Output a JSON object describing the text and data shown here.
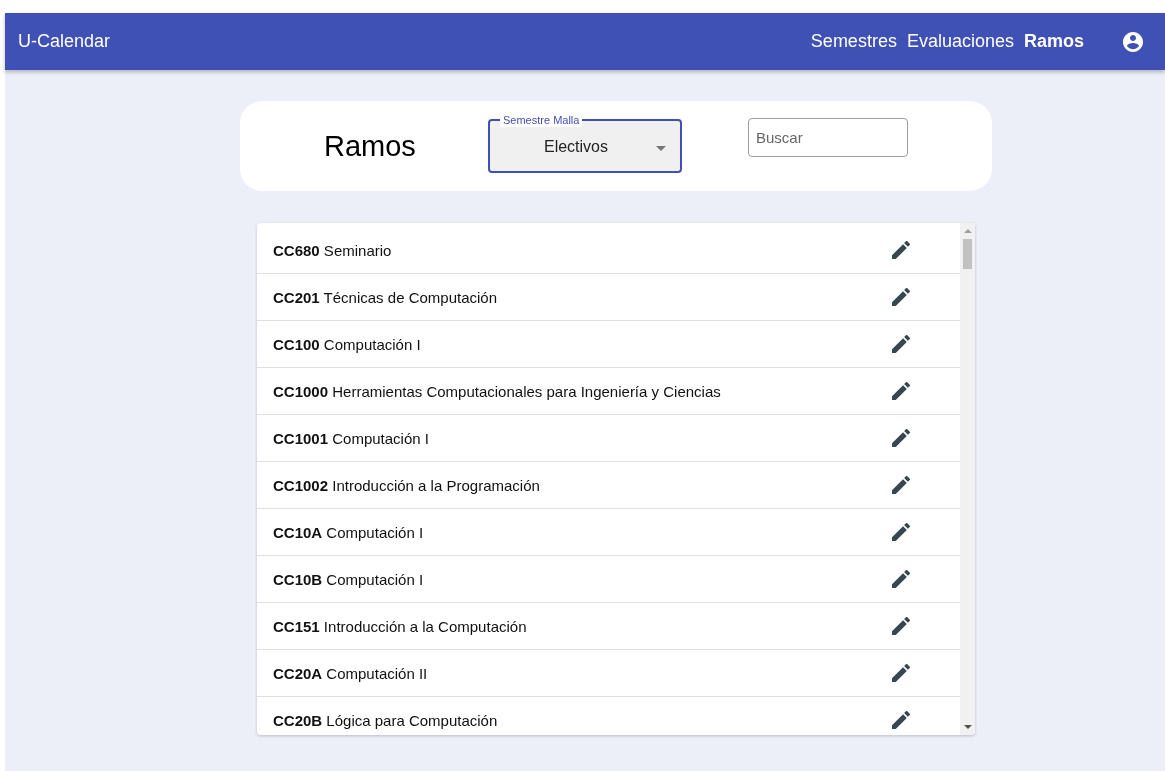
{
  "app_bar": {
    "title": "U-Calendar",
    "nav": [
      {
        "label": "Semestres",
        "selected": false
      },
      {
        "label": "Evaluaciones",
        "selected": false
      },
      {
        "label": "Ramos",
        "selected": true
      }
    ]
  },
  "header_card": {
    "title": "Ramos",
    "select": {
      "label": "Semestre Malla",
      "value": "Electivos"
    },
    "search": {
      "placeholder": "Buscar"
    }
  },
  "courses": [
    {
      "code": "CC680",
      "name": "Seminario"
    },
    {
      "code": "CC201",
      "name": "Técnicas de Computación"
    },
    {
      "code": "CC100",
      "name": "Computación I"
    },
    {
      "code": "CC1000",
      "name": "Herramientas Computacionales para Ingeniería y Ciencias"
    },
    {
      "code": "CC1001",
      "name": "Computación I"
    },
    {
      "code": "CC1002",
      "name": "Introducción a la Programación"
    },
    {
      "code": "CC10A",
      "name": "Computación I"
    },
    {
      "code": "CC10B",
      "name": "Computación I"
    },
    {
      "code": "CC151",
      "name": "Introducción a la Computación"
    },
    {
      "code": "CC20A",
      "name": "Computación II"
    },
    {
      "code": "CC20B",
      "name": "Lógica para Computación"
    }
  ]
}
